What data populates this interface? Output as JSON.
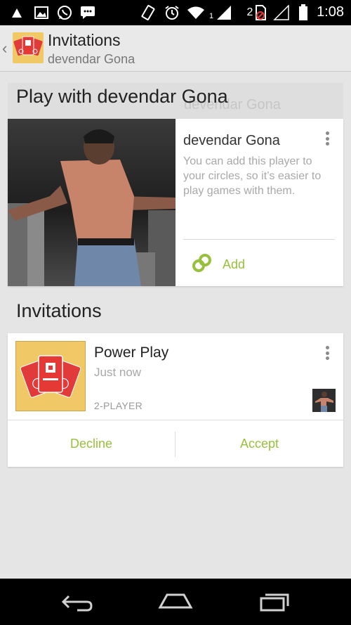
{
  "status_bar": {
    "time": "1:08",
    "sim_label": "2",
    "signal_label": "1",
    "icons": [
      "notification-icon",
      "image-icon",
      "whatsapp-icon",
      "chat-icon",
      "vibrate-icon",
      "alarm-icon",
      "wifi-icon",
      "signal-icon",
      "sim-icon",
      "no-signal-icon",
      "battery-icon"
    ]
  },
  "action_bar": {
    "title": "Invitations",
    "subtitle": "devendar Gona"
  },
  "player_section": {
    "heading": "Play with devendar Gona",
    "ghost_name": "devendar Gona",
    "player_name": "devendar Gona",
    "description": "You can add this player to your circles, so it’s easier to play games with them.",
    "add_label": "Add"
  },
  "invitations_section": {
    "heading": "Invitations",
    "items": [
      {
        "game_name": "Power Play",
        "time": "Just now",
        "mode": "2-PLAYER",
        "decline_label": "Decline",
        "accept_label": "Accept"
      }
    ]
  },
  "colors": {
    "accent": "#99c03c",
    "game_icon_bg": "#f0c866",
    "card_red": "#e03a3a"
  },
  "nav_bar": {
    "icons": [
      "back-icon",
      "home-icon",
      "recent-apps-icon"
    ]
  }
}
